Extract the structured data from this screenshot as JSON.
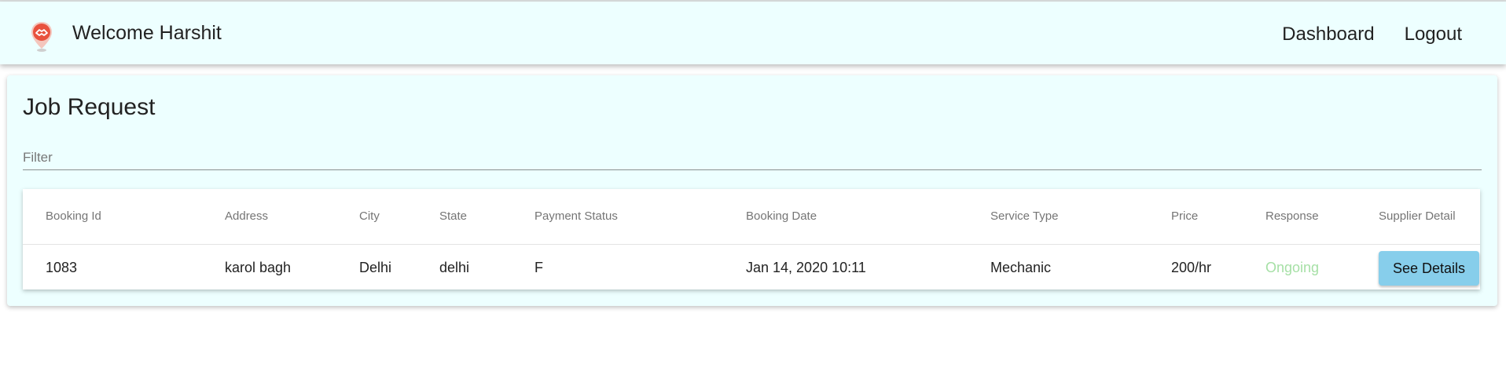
{
  "header": {
    "welcome": "Welcome Harshit",
    "nav": {
      "dashboard": "Dashboard",
      "logout": "Logout"
    },
    "logo_icon": "handshake-pin-icon",
    "logo_color": "#e8523e"
  },
  "main": {
    "title": "Job Request",
    "filter_placeholder": "Filter",
    "filter_value": "",
    "table": {
      "headers": {
        "booking_id": "Booking Id",
        "address": "Address",
        "city": "City",
        "state": "State",
        "payment_status": "Payment Status",
        "booking_date": "Booking Date",
        "service_type": "Service Type",
        "price": "Price",
        "response": "Response",
        "supplier_detail": "Supplier Detail"
      },
      "rows": [
        {
          "booking_id": "1083",
          "address": "karol bagh",
          "city": "Delhi",
          "state": "delhi",
          "payment_status": "F",
          "booking_date": "Jan 14, 2020 10:11",
          "service_type": "Mechanic",
          "price": "200/hr",
          "response": "Ongoing",
          "action_label": "See Details"
        }
      ]
    }
  },
  "colors": {
    "header_bg": "#edffff",
    "ongoing": "#a6e0a6",
    "button_bg": "#87ceeb"
  }
}
